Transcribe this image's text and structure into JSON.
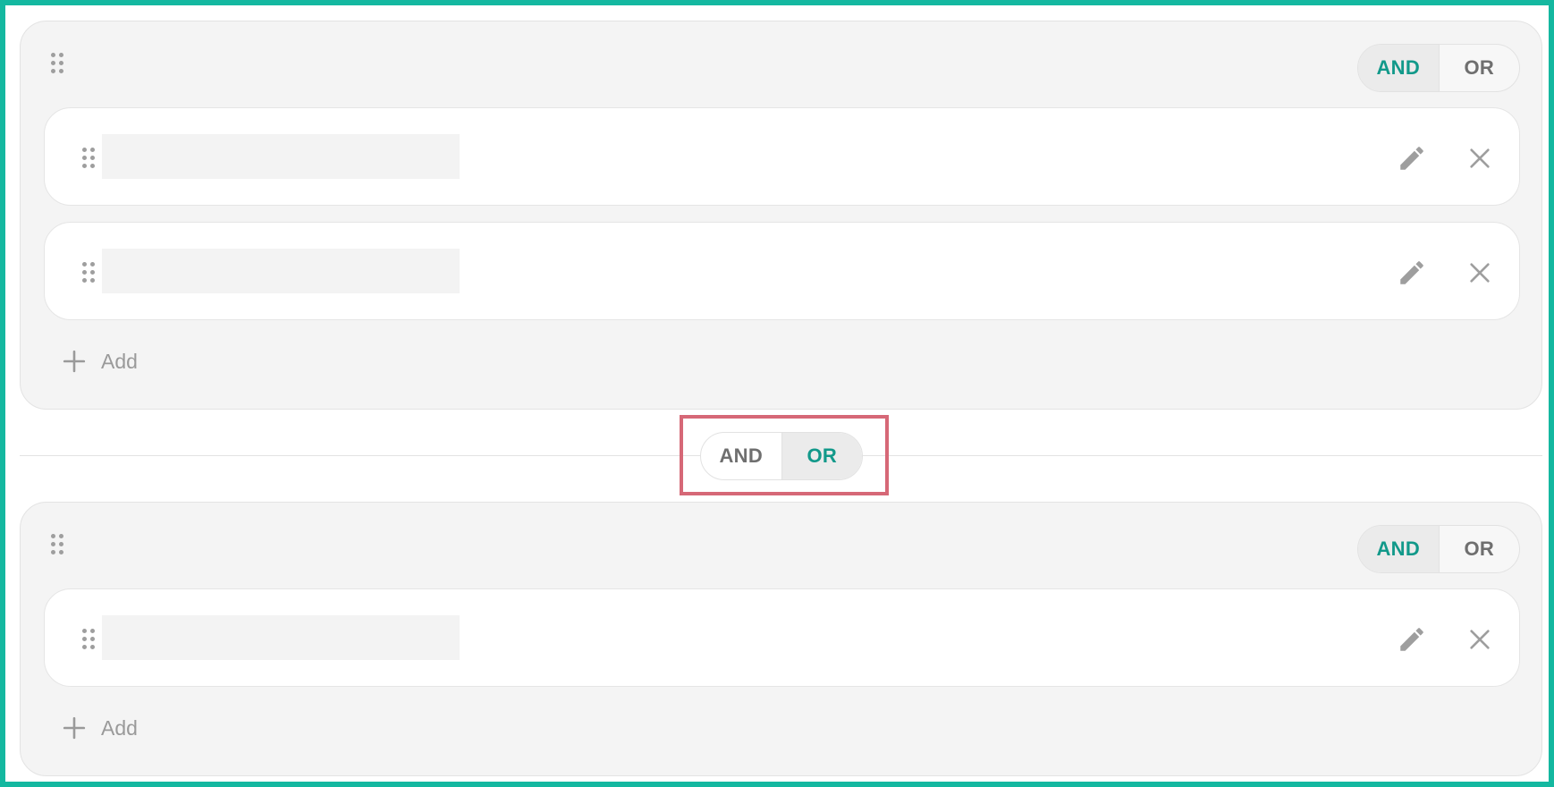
{
  "groups": [
    {
      "operator": {
        "and_label": "AND",
        "or_label": "OR",
        "selected": "AND"
      },
      "conditions": [
        {
          "value": ""
        },
        {
          "value": ""
        }
      ],
      "add_label": "Add"
    },
    {
      "operator": {
        "and_label": "AND",
        "or_label": "OR",
        "selected": "AND"
      },
      "conditions": [
        {
          "value": ""
        }
      ],
      "add_label": "Add"
    }
  ],
  "group_connector": {
    "and_label": "AND",
    "or_label": "OR",
    "selected": "OR"
  },
  "colors": {
    "frame": "#14b8a0",
    "accent": "#12998a",
    "highlight": "#d66877",
    "icon": "#9e9e9e"
  },
  "icons": {
    "drag": "drag-handle-icon",
    "edit": "pencil-icon",
    "remove": "close-icon",
    "add": "plus-icon"
  }
}
